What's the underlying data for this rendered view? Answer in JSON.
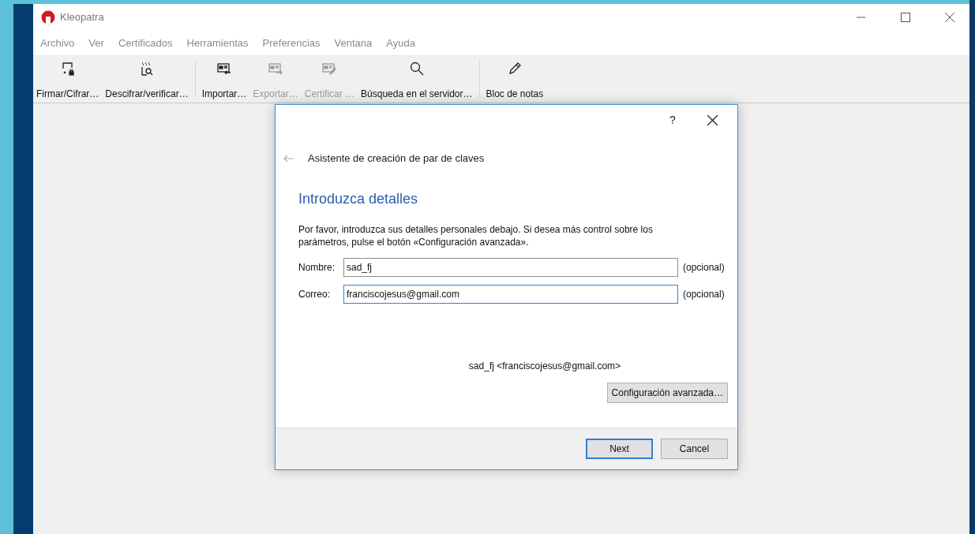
{
  "window": {
    "title": "Kleopatra"
  },
  "menu": [
    "Archivo",
    "Ver",
    "Certificados",
    "Herramientas",
    "Preferencias",
    "Ventana",
    "Ayuda"
  ],
  "toolbar_groups": [
    {
      "items": [
        {
          "label": "Firmar/Cifrar…",
          "kind": "sign",
          "disabled": false
        },
        {
          "label": "Descifrar/verificar…",
          "kind": "decrypt",
          "disabled": false
        }
      ]
    },
    {
      "items": [
        {
          "label": "Importar…",
          "kind": "import",
          "disabled": false
        },
        {
          "label": "Exportar…",
          "kind": "export",
          "disabled": true
        },
        {
          "label": "Certificar …",
          "kind": "certify",
          "disabled": true
        },
        {
          "label": "Búsqueda en el servidor…",
          "kind": "search",
          "disabled": false
        }
      ]
    },
    {
      "items": [
        {
          "label": "Bloc de notas",
          "kind": "notepad",
          "disabled": false
        }
      ]
    }
  ],
  "dialog": {
    "help": "?",
    "title": "Asistente de creación de par de claves",
    "heading": "Introduzca detalles",
    "text": "Por favor, introduzca sus detalles personales debajo. Si desea más control sobre los parámetros, pulse el botón «Configuración avanzada».",
    "fields": [
      {
        "label": "Nombre:",
        "value": "sad_fj",
        "note": "(opcional)",
        "focused": false
      },
      {
        "label": "Correo:",
        "value": "franciscojesus@gmail.com",
        "note": "(opcional)",
        "focused": true
      }
    ],
    "summary": "sad_fj <franciscojesus@gmail.com>",
    "advanced_button": "Configuración avanzada…",
    "buttons": [
      {
        "label": "Next",
        "default": true
      },
      {
        "label": "Cancel",
        "default": false
      }
    ]
  }
}
